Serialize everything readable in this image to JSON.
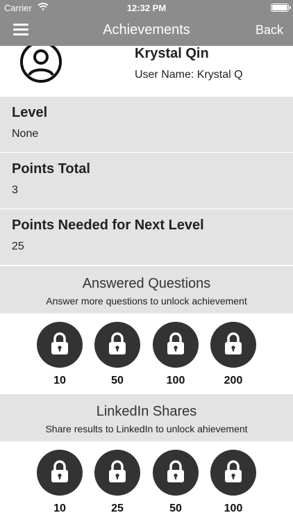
{
  "status_bar": {
    "carrier": "Carrier",
    "time": "12:32 PM"
  },
  "nav": {
    "title": "Achievements",
    "back_label": "Back"
  },
  "profile": {
    "name": "Krystal Qin",
    "username": "User Name: Krystal Q"
  },
  "info_rows": [
    {
      "label": "Level",
      "value": "None"
    },
    {
      "label": "Points Total",
      "value": "3"
    },
    {
      "label": "Points Needed for Next Level",
      "value": "25"
    }
  ],
  "sections": [
    {
      "title": "Answered Questions",
      "subtitle": "Answer more questions to unlock achievement",
      "badges": [
        "10",
        "50",
        "100",
        "200"
      ]
    },
    {
      "title": "LinkedIn Shares",
      "subtitle": "Share results to LinkedIn to unlock ahievement",
      "badges": [
        "10",
        "25",
        "50",
        "100"
      ]
    }
  ],
  "icons": {
    "menu": "hamburger-icon",
    "avatar": "user-circle-icon",
    "badge": "lock-icon",
    "wifi": "wifi-icon",
    "battery": "battery-icon"
  }
}
